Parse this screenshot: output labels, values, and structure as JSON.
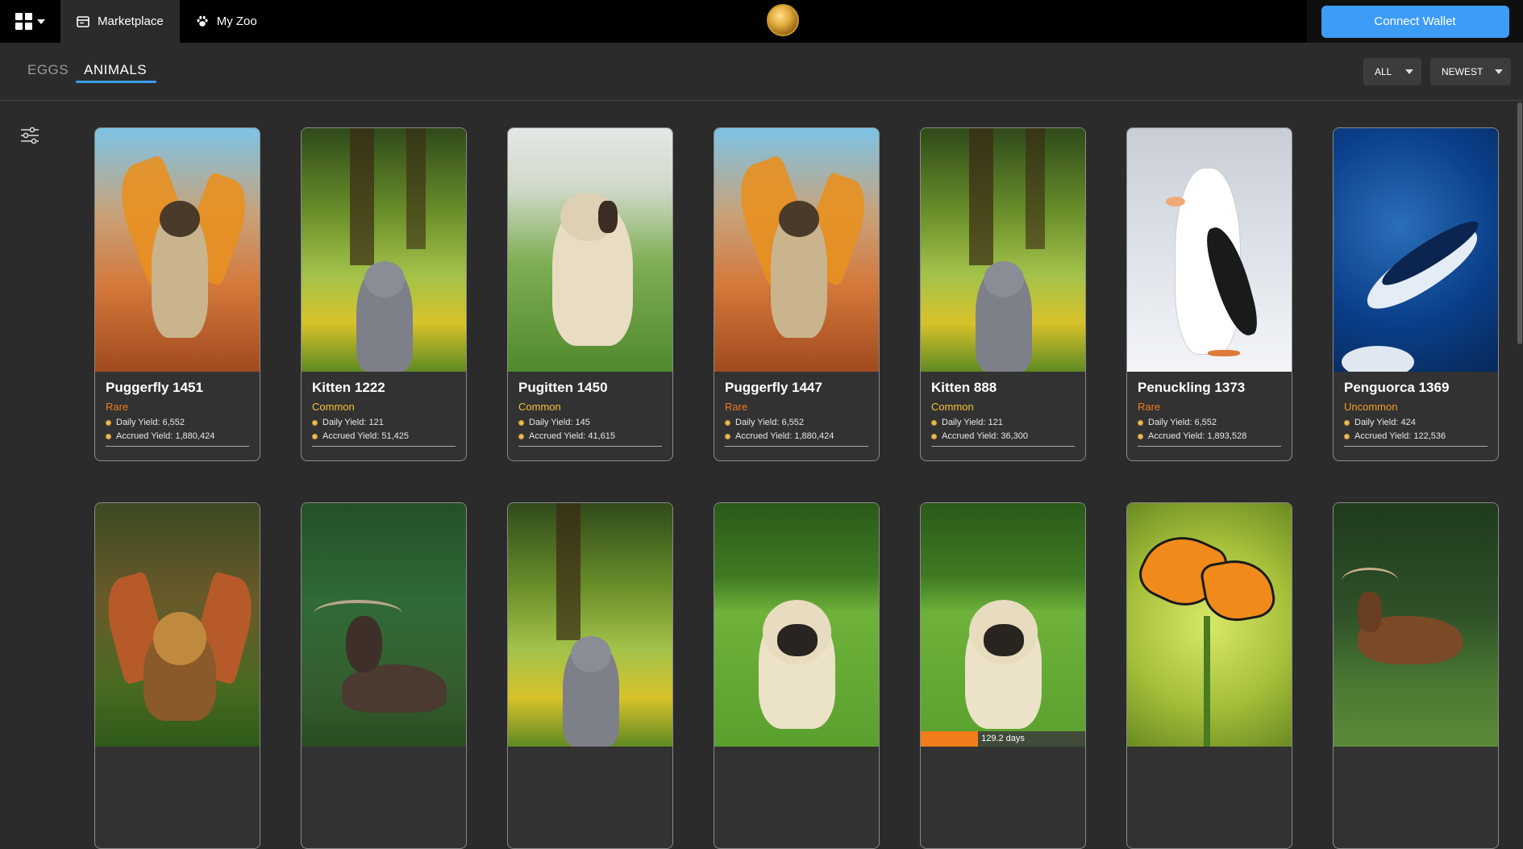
{
  "header": {
    "tabs": [
      {
        "label": "Marketplace",
        "icon": "store-icon",
        "active": true
      },
      {
        "label": "My Zoo",
        "icon": "paw-icon",
        "active": false
      }
    ],
    "connect_wallet_label": "Connect Wallet"
  },
  "subnav": {
    "tabs": [
      {
        "label": "EGGS",
        "active": false
      },
      {
        "label": "ANIMALS",
        "active": true
      }
    ],
    "filter_all": "ALL",
    "sort": "NEWEST"
  },
  "colors": {
    "accent": "#3d9cf5",
    "rare": "#f07c1a",
    "common": "#f5c33a",
    "uncommon": "#f0a020"
  },
  "cards_row1": [
    {
      "name": "Puggerfly 1451",
      "rarity": "Rare",
      "daily": "Daily Yield: 6,552",
      "accrued": "Accrued Yield: 1,880,424"
    },
    {
      "name": "Kitten 1222",
      "rarity": "Common",
      "daily": "Daily Yield: 121",
      "accrued": "Accrued Yield: 51,425"
    },
    {
      "name": "Pugitten 1450",
      "rarity": "Common",
      "daily": "Daily Yield: 145",
      "accrued": "Accrued Yield: 41,615"
    },
    {
      "name": "Puggerfly 1447",
      "rarity": "Rare",
      "daily": "Daily Yield: 6,552",
      "accrued": "Accrued Yield: 1,880,424"
    },
    {
      "name": "Kitten 888",
      "rarity": "Common",
      "daily": "Daily Yield: 121",
      "accrued": "Accrued Yield: 36,300"
    },
    {
      "name": "Penuckling 1373",
      "rarity": "Rare",
      "daily": "Daily Yield: 6,552",
      "accrued": "Accrued Yield: 1,893,528"
    },
    {
      "name": "Penguorca 1369",
      "rarity": "Uncommon",
      "daily": "Daily Yield: 424",
      "accrued": "Accrued Yield: 122,536"
    }
  ],
  "cards_row2_progress": {
    "label": "129.2 days",
    "fraction": 0.35
  }
}
